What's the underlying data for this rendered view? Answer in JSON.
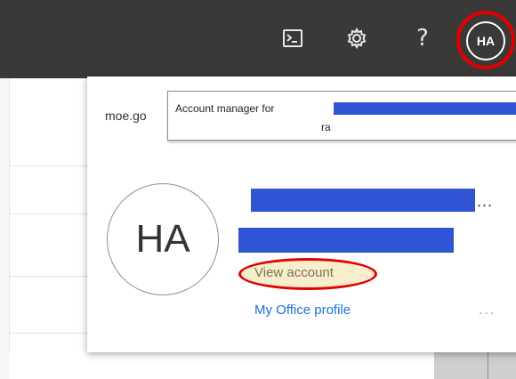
{
  "topbar": {
    "icons": [
      "terminal-icon",
      "gear-icon",
      "help-icon"
    ],
    "help_glyph": "?",
    "avatar_initials": "HA"
  },
  "account_panel": {
    "organization_partial": "moe.go",
    "tooltip": {
      "label": "Account manager for",
      "line2": "ra"
    },
    "avatar_initials": "HA",
    "name_ellipsis": "...",
    "links": {
      "view_account": "View account",
      "office_profile": "My Office profile"
    },
    "more_options": "..."
  },
  "colors": {
    "topbar": "#3b3937",
    "redaction": "#2f55d4",
    "highlight": "#e00000",
    "link": "#1a6fd6"
  }
}
